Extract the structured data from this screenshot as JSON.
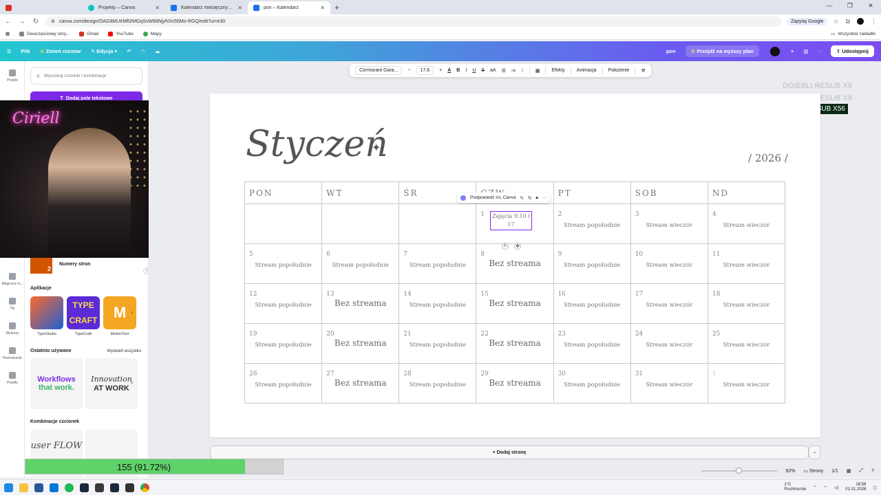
{
  "browser": {
    "tabs": [
      {
        "title": "Projekty – Canva",
        "active": false
      },
      {
        "title": "Kalendarz miesięczny – listopad…",
        "active": false
      },
      {
        "title": "pon – Kalendarz",
        "active": true
      }
    ],
    "url": "canva.com/design/DAG9MUIrMf0/MGqSvW66NjyNXv55Mo-RGQ/edit?ui=e30",
    "ask_google": "Zapytaj Google",
    "bookmarks": [
      "Dwuczęściowy stroj...",
      "Gmail",
      "YouTube",
      "Mapy"
    ],
    "all_bookmarks": "Wszystkie zakładki"
  },
  "canva_top": {
    "file": "Plik",
    "resize": "Zmień rozmiar",
    "edit": "Edycja",
    "doc_name": "pon",
    "upgrade": "Przejdź na wyższy plan",
    "share": "Udostępnij"
  },
  "rail": [
    {
      "label": "Projekt",
      "icon": "layout-icon"
    },
    {
      "label": "Magiczne m...",
      "icon": "magic-icon"
    },
    {
      "label": "Tło",
      "icon": "background-icon"
    },
    {
      "label": "Wykresy",
      "icon": "chart-icon"
    },
    {
      "label": "Rozmazanie",
      "icon": "blur-icon"
    },
    {
      "label": "Pixelify",
      "icon": "pixel-icon"
    }
  ],
  "panel": {
    "search_placeholder": "Wyszukaj czcionki i kombinacje",
    "add_text": "Dodaj pole tekstowe",
    "page_numbers": "Numery stron",
    "apps_title": "Aplikacje",
    "apps": [
      {
        "label": "TypeStudio",
        "color": "#1f3b73"
      },
      {
        "label": "TypeCraft",
        "color": "#5b2bd6"
      },
      {
        "label": "MotionText",
        "color": "#f4a623"
      }
    ],
    "recent_title": "Ostatnio używane",
    "recent_link": "Wyświetl wszystko",
    "recent": [
      {
        "line1": "Workflows",
        "line2": "that work."
      },
      {
        "line1": "Innovation",
        "line2": "AT WORK"
      }
    ],
    "combos_title": "Kombinacje czcionek",
    "combo_text": "user FLOW"
  },
  "webcam": {
    "neon": "Ciriell"
  },
  "toolbar": {
    "font": "Cormorant Gara...",
    "minus": "−",
    "size": "17,6",
    "plus": "+",
    "effects": "Efekty",
    "animation": "Animacja",
    "position": "Położenie"
  },
  "calendar": {
    "month": "Styczeń",
    "sparkle": "✦",
    "year": "/ 2026 /",
    "headers": [
      "PON",
      "WT",
      "ŚR",
      "CZW",
      "PT",
      "SOB",
      "ND"
    ],
    "weeks": [
      [
        {
          "d": "",
          "e": ""
        },
        {
          "d": "",
          "e": ""
        },
        {
          "d": "",
          "e": ""
        },
        {
          "d": "1",
          "e": ""
        },
        {
          "d": "2",
          "e": "Stream popołudnie"
        },
        {
          "d": "3",
          "e": "Stream wieczór"
        },
        {
          "d": "4",
          "e": "Stream wieczór"
        }
      ],
      [
        {
          "d": "5",
          "e": "Stream popołudnie"
        },
        {
          "d": "6",
          "e": "Stream popołudnie"
        },
        {
          "d": "7",
          "e": "Stream popołudnie"
        },
        {
          "d": "8",
          "e": "Bez streama"
        },
        {
          "d": "9",
          "e": "Stream popołudnie"
        },
        {
          "d": "10",
          "e": "Stream wieczór"
        },
        {
          "d": "11",
          "e": "Stream wieczór"
        }
      ],
      [
        {
          "d": "12",
          "e": "Stream popołudnie"
        },
        {
          "d": "13",
          "e": "Bez streama"
        },
        {
          "d": "14",
          "e": "Stream popołudnie"
        },
        {
          "d": "15",
          "e": "Bez streama"
        },
        {
          "d": "16",
          "e": "Stream popołudnie"
        },
        {
          "d": "17",
          "e": "Stream wieczór"
        },
        {
          "d": "18",
          "e": "Stream wieczór"
        }
      ],
      [
        {
          "d": "19",
          "e": "Stream popołudnie"
        },
        {
          "d": "20",
          "e": "Bez streama"
        },
        {
          "d": "21",
          "e": "Stream popołudnie"
        },
        {
          "d": "22",
          "e": "Bez streama"
        },
        {
          "d": "23",
          "e": "Stream popołudnie"
        },
        {
          "d": "24",
          "e": "Stream wieczór"
        },
        {
          "d": "25",
          "e": "Stream wieczór"
        }
      ],
      [
        {
          "d": "26",
          "e": "Stream popołudnie"
        },
        {
          "d": "27",
          "e": "Bez streama"
        },
        {
          "d": "28",
          "e": "Stream popołudnie"
        },
        {
          "d": "29",
          "e": "Bez streama"
        },
        {
          "d": "30",
          "e": "Stream popołudnie"
        },
        {
          "d": "31",
          "e": "Stream wieczór"
        },
        {
          "d": "1",
          "e": "Stream wieczór"
        }
      ]
    ],
    "editing_text": "Zajęcia 9.10 i 17"
  },
  "context_pill": "Podpowiedz mi, Canva",
  "add_page": "+ Dodaj stronę",
  "overlay": {
    "line1": "DGIEBLI  RESUB X9",
    "line2": "MRUKT5657  RESUB X8",
    "badge": "ARKO098  RESUB X56"
  },
  "bottom": {
    "zoom": "92%",
    "zoom_level": 0.5,
    "pages_label": "Strony",
    "page_counter": "1/1"
  },
  "progress": {
    "label": "155 (91.72%)",
    "percent": 91.72
  },
  "taskbar": {
    "weather_temp": "1°C",
    "weather_desc": "Pochmurnie",
    "time": "18:58",
    "date": "01.01.2026"
  }
}
